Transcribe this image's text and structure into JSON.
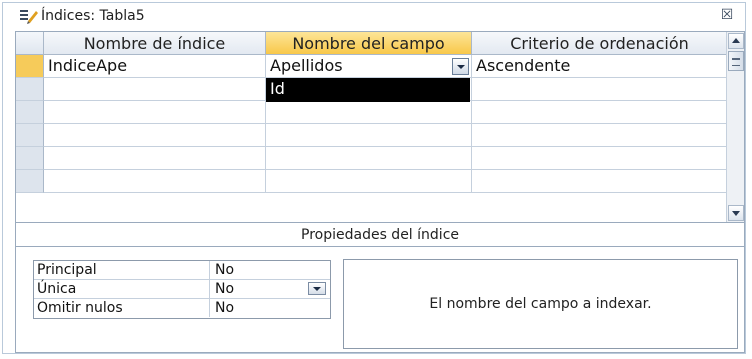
{
  "window": {
    "title": "Índices: Tabla5",
    "close_glyph": "☒"
  },
  "grid": {
    "columns": [
      "Nombre de índice",
      "Nombre del campo",
      "Criterio de ordenación"
    ],
    "active_column": 1,
    "rows": [
      {
        "index_name": "IndiceApe",
        "field_name": "Apellidos",
        "sort_order": "Ascendente"
      },
      {
        "index_name": "",
        "field_name": "",
        "sort_order": ""
      },
      {
        "index_name": "",
        "field_name": "",
        "sort_order": ""
      },
      {
        "index_name": "",
        "field_name": "",
        "sort_order": ""
      },
      {
        "index_name": "",
        "field_name": "",
        "sort_order": ""
      }
    ],
    "dropdown_options": [
      "Id"
    ]
  },
  "properties": {
    "title": "Propiedades del índice",
    "rows": [
      {
        "label": "Principal",
        "value": "No"
      },
      {
        "label": "Única",
        "value": "No"
      },
      {
        "label": "Omitir nulos",
        "value": "No"
      }
    ],
    "help_text": "El nombre del campo a indexar."
  },
  "colors": {
    "active_header": "#f8c84a",
    "current_row_selector": "#f6cb5a",
    "dropdown_bg": "#000000"
  }
}
